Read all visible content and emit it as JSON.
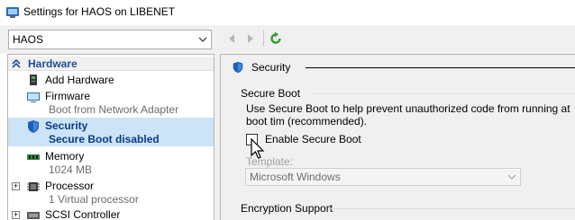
{
  "window": {
    "title": "Settings for HAOS on LIBENET",
    "icon": "settings-window-icon"
  },
  "toolbar": {
    "vm_select_value": "HAOS",
    "back_icon": "back-arrow-icon",
    "forward_icon": "forward-arrow-icon",
    "refresh_icon": "refresh-icon"
  },
  "sidebar": {
    "header": "Hardware",
    "items": [
      {
        "label": "Add Hardware",
        "sub": "",
        "icon": "add-hardware-icon"
      },
      {
        "label": "Firmware",
        "sub": "Boot from Network Adapter",
        "icon": "firmware-icon"
      },
      {
        "label": "Security",
        "sub": "Secure Boot disabled",
        "icon": "shield-icon"
      },
      {
        "label": "Memory",
        "sub": "1024 MB",
        "icon": "memory-icon"
      },
      {
        "label": "Processor",
        "sub": "1 Virtual processor",
        "icon": "processor-icon"
      },
      {
        "label": "SCSI Controller",
        "sub": "",
        "icon": "scsi-controller-icon"
      }
    ]
  },
  "main": {
    "section_title": "Security",
    "secure_boot": {
      "group_title": "Secure Boot",
      "description": "Use Secure Boot to help prevent unauthorized code from running at boot tim (recommended).",
      "checkbox_label": "Enable Secure Boot",
      "checked": false,
      "template_label": "Template:",
      "template_value": "Microsoft Windows"
    },
    "encryption": {
      "group_title": "Encryption Support"
    }
  },
  "colors": {
    "accent": "#1f4e99",
    "selected_bg": "#cce4f7",
    "panel_bg": "#f0f0f0",
    "refresh_green": "#2e9e2e"
  }
}
